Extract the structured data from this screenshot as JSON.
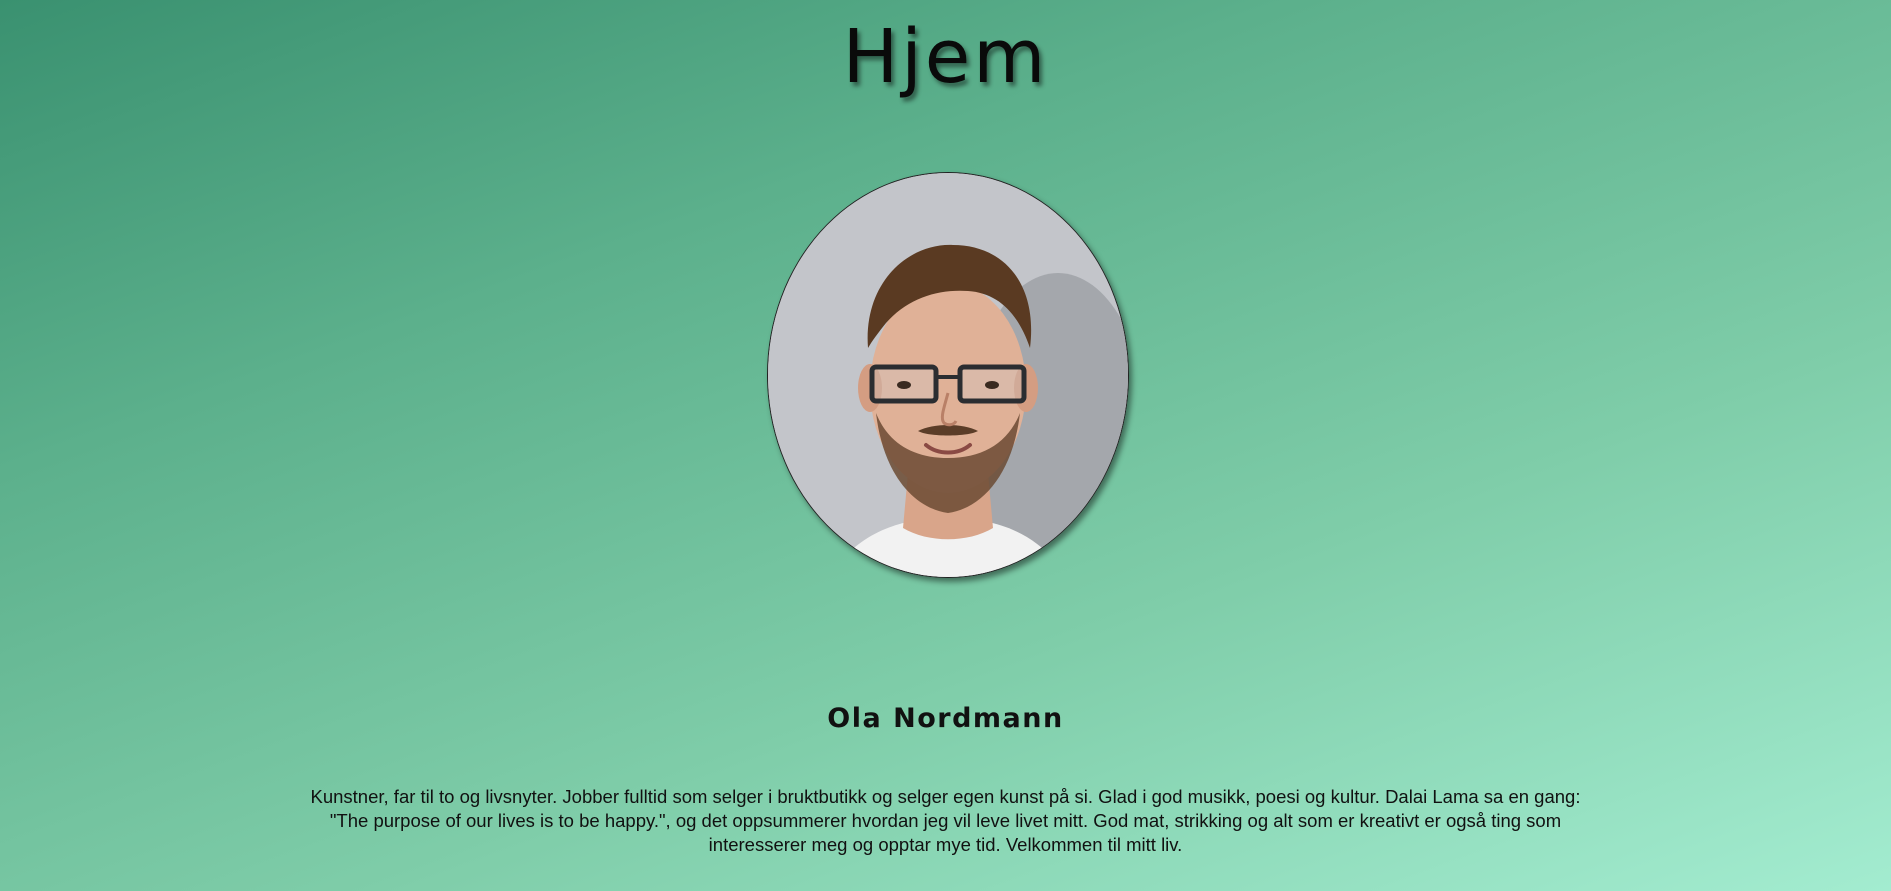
{
  "header": {
    "title": "Hjem"
  },
  "profile": {
    "photo_alt": "portrait-photo",
    "name": "Ola Nordmann",
    "bio": "Kunstner, far til to og livsnyter. Jobber fulltid som selger i bruktbutikk og selger egen kunst på si. Glad i god musikk, poesi og kultur. Dalai Lama sa en gang: \"The purpose of our lives is to be happy.\", og det oppsummerer hvordan jeg vil leve livet mitt. God mat, strikking og alt som er kreativt er også ting som interesserer meg og opptar mye tid. Velkommen til mitt liv."
  },
  "colors": {
    "background_start": "#3a9170",
    "background_end": "#a3ecd0",
    "text": "#111111"
  }
}
